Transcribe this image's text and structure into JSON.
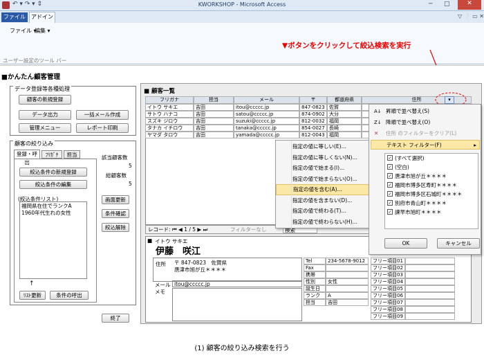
{
  "window": {
    "title": "KWORKSHOP - Microsoft Access",
    "tabs": [
      "ファイル",
      "アドイン"
    ],
    "ribbon_menu": [
      "ファイル ▾",
      "編集 ▾"
    ],
    "ribbon_group": "ユーザー設定のツール バー"
  },
  "annotation": "▼ボタンをクリックして絞込検索を実行",
  "form_title": "■かんたん顧客管理",
  "left": {
    "g1_title": "データ登録等各種処理",
    "btn_new": "顧客の新規登録",
    "btn_export": "データ出力",
    "btn_mail": "一括メール作成",
    "btn_menu": "管理メニュー",
    "btn_report": "レポート印刷",
    "g2_title": "顧客の絞り込み",
    "tabs": [
      "登録・呼出",
      "ﾌﾘｶﾞﾅ",
      "担当"
    ],
    "btn_cond_new": "絞込条件の新規登録",
    "btn_cond_edit": "絞込条件の編集",
    "list_label": "(絞込条件リスト)",
    "list_items": [
      "福岡県在住でランクA",
      "1960年代生れの女性"
    ],
    "arrow": "↑",
    "btn_list_refresh": "ﾘｽﾄ更新",
    "btn_cond_call": "条件の呼出",
    "count1_label": "該当顧客数",
    "count1": "5",
    "count2_label": "総顧客数",
    "count2": "5",
    "btn_refresh": "画面更新",
    "btn_confirm": "条件確認",
    "btn_clear": "絞込解除",
    "btn_end": "終了"
  },
  "list": {
    "title": "■ 顧客一覧",
    "headers": [
      "フリガナ",
      "担当",
      "メール",
      "〒",
      "都道府県",
      "住所"
    ],
    "rows": [
      [
        "イトウ サキエ",
        "吉田",
        "itou@ccccc.jp",
        "847-0823",
        "佐賀"
      ],
      [
        "サトウ ハナコ",
        "吉田",
        "satou@ccccc.jp",
        "874-0902",
        "大分"
      ],
      [
        "スズキ ジロウ",
        "吉田",
        "suzuki@ccccc.jp",
        "812-0032",
        "福岡"
      ],
      [
        "タナカ イチロウ",
        "吉田",
        "tanaka@ccccc.jp",
        "854-0027",
        "長崎"
      ],
      [
        "ヤマダ タロウ",
        "吉田",
        "yamada@ccccc.jp",
        "812-0043",
        "福岡"
      ]
    ],
    "record": "レコード: ⏮ ◀ 1 / 5 ▶ ⏭",
    "no_filter": "フィルターなし",
    "search": "検索"
  },
  "menu1": [
    "指定の値に等しい(E)...",
    "指定の値に等しくない(N)...",
    "指定の値で始まる(I)...",
    "指定の値で始まらない(O)...",
    "指定の値を含む(A)...",
    "指定の値を含まない(D)...",
    "指定の値で終わる(T)...",
    "指定の値で終わらない(H)..."
  ],
  "menu2": {
    "sort_asc": "昇順で並べ替え(S)",
    "sort_desc": "降順で並べ替え(O)",
    "clear": "住所 のフィルターをクリア(L)",
    "text_filter": "テキスト フィルター(F)",
    "items": [
      "(すべて選択)",
      "(空白)",
      "唐津市旭が丘＊＊＊＊",
      "福岡市博多区寿町＊＊＊＊",
      "福岡市博多区石城町＊＊＊＊",
      "別府市青山町＊＊＊＊",
      "諫早市旭町＊＊＊＊"
    ],
    "ok": "OK",
    "cancel": "キャンセル"
  },
  "detail": {
    "kana": "イトウ サキエ",
    "name": "伊藤　咲江",
    "addr_label": "住所",
    "zip": "〒 847-0823　佐賀県",
    "addr": "唐津市旭が丘＊＊＊＊",
    "mail_label": "メール",
    "mail": "itou@ccccc.jp",
    "memo_label": "メモ",
    "info": [
      [
        "Tel",
        "234-5678-9012"
      ],
      [
        "Fax",
        ""
      ],
      [
        "携帯",
        ""
      ],
      [
        "性別",
        "女性"
      ],
      [
        "誕生日",
        ""
      ],
      [
        "ランク",
        "A"
      ],
      [
        "担当",
        "吉田"
      ]
    ],
    "free": [
      "フリー項目01",
      "フリー項目02",
      "フリー項目03",
      "フリー項目04",
      "フリー項目05",
      "フリー項目06",
      "フリー項目07",
      "フリー項目08",
      "フリー項目09"
    ]
  },
  "caption": "(1) 顧客の絞り込み検索を行う"
}
